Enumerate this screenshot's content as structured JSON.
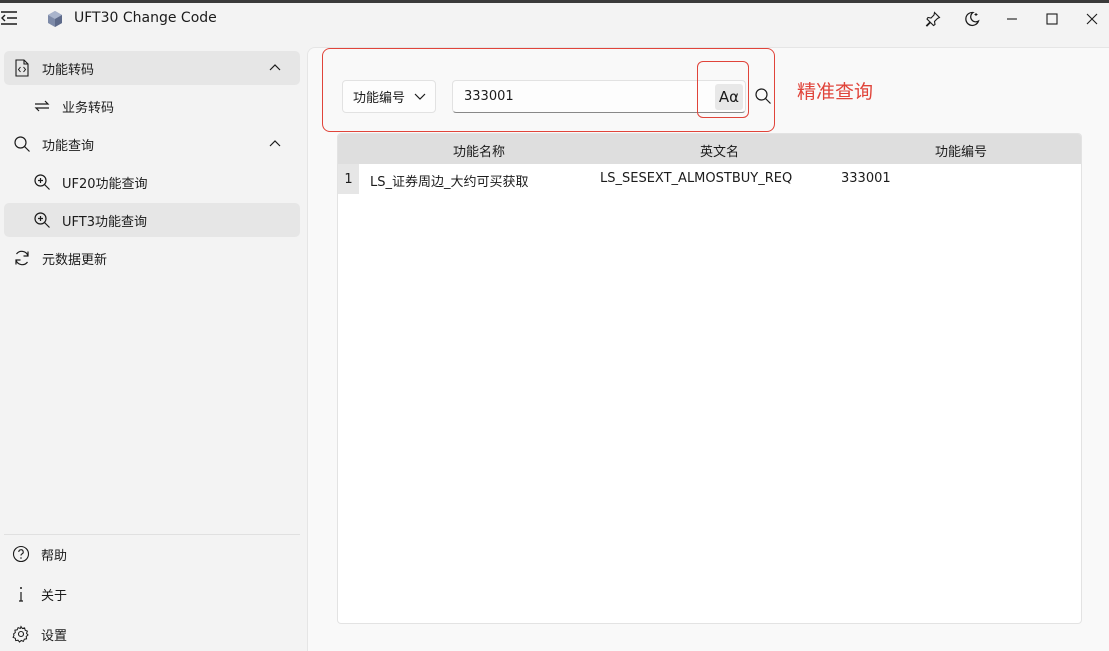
{
  "window": {
    "title": "UFT30 Change Code",
    "controls": [
      "pin-icon",
      "theme-icon",
      "minimize-icon",
      "maximize-icon",
      "close-icon"
    ]
  },
  "sidebar": {
    "items": [
      {
        "label": "功能转码",
        "icon": "code-file-icon",
        "expanded": true
      },
      {
        "label": "业务转码",
        "icon": "swap-icon"
      },
      {
        "label": "功能查询",
        "icon": "search-icon",
        "expanded": true
      },
      {
        "label": "UF20功能查询",
        "icon": "zoom-in-icon"
      },
      {
        "label": "UFT3功能查询",
        "icon": "zoom-in-icon",
        "selected": true
      },
      {
        "label": "元数据更新",
        "icon": "refresh-icon"
      }
    ],
    "footer": [
      {
        "label": "帮助",
        "icon": "help-icon"
      },
      {
        "label": "关于",
        "icon": "info-icon"
      },
      {
        "label": "设置",
        "icon": "gear-icon"
      }
    ]
  },
  "query": {
    "field_selected": "功能编号",
    "search_value": "333001",
    "case_toggle_label": "Aα",
    "annotation": "精准查询"
  },
  "table": {
    "columns": [
      "功能名称",
      "英文名",
      "功能编号"
    ],
    "rows": [
      {
        "index": "1",
        "cells": [
          "LS_证券周边_大约可买获取",
          "LS_SESEXT_ALMOSTBUY_REQ",
          "333001"
        ]
      }
    ]
  },
  "colors": {
    "accent": "#0067c0",
    "annotation": "#e0443a"
  }
}
